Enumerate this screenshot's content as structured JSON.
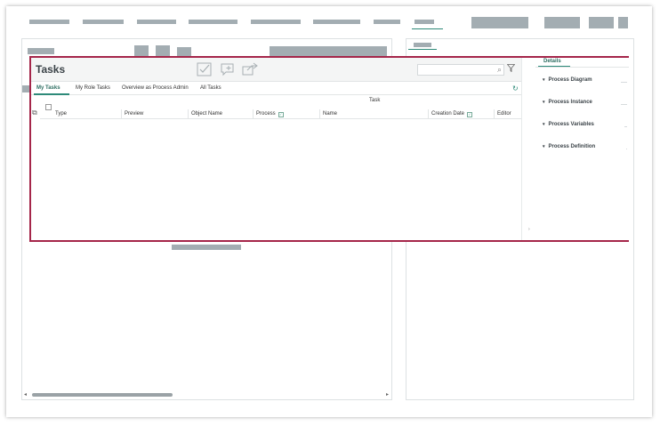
{
  "tasks": {
    "title": "Tasks",
    "toolbar": {
      "icons": [
        "complete-task-icon",
        "comment-icon",
        "forward-icon"
      ],
      "search_placeholder": ""
    },
    "tabs": [
      {
        "label": "My Tasks",
        "active": true
      },
      {
        "label": "My Role Tasks",
        "active": false
      },
      {
        "label": "Overview as Process Admin",
        "active": false
      },
      {
        "label": "All Tasks",
        "active": false
      }
    ],
    "column_group": "Task",
    "columns": [
      "Type",
      "Preview",
      "Object Name",
      "Process",
      "Name",
      "Creation Date",
      "Editor"
    ]
  },
  "details": {
    "tab_label": "Details",
    "sections": [
      "Process Diagram",
      "Process Instance",
      "Process Variables",
      "Process Definition"
    ]
  },
  "colors": {
    "accent": "#2e8a79",
    "focus_border": "#a5264a",
    "placeholder": "#a3adb2"
  }
}
